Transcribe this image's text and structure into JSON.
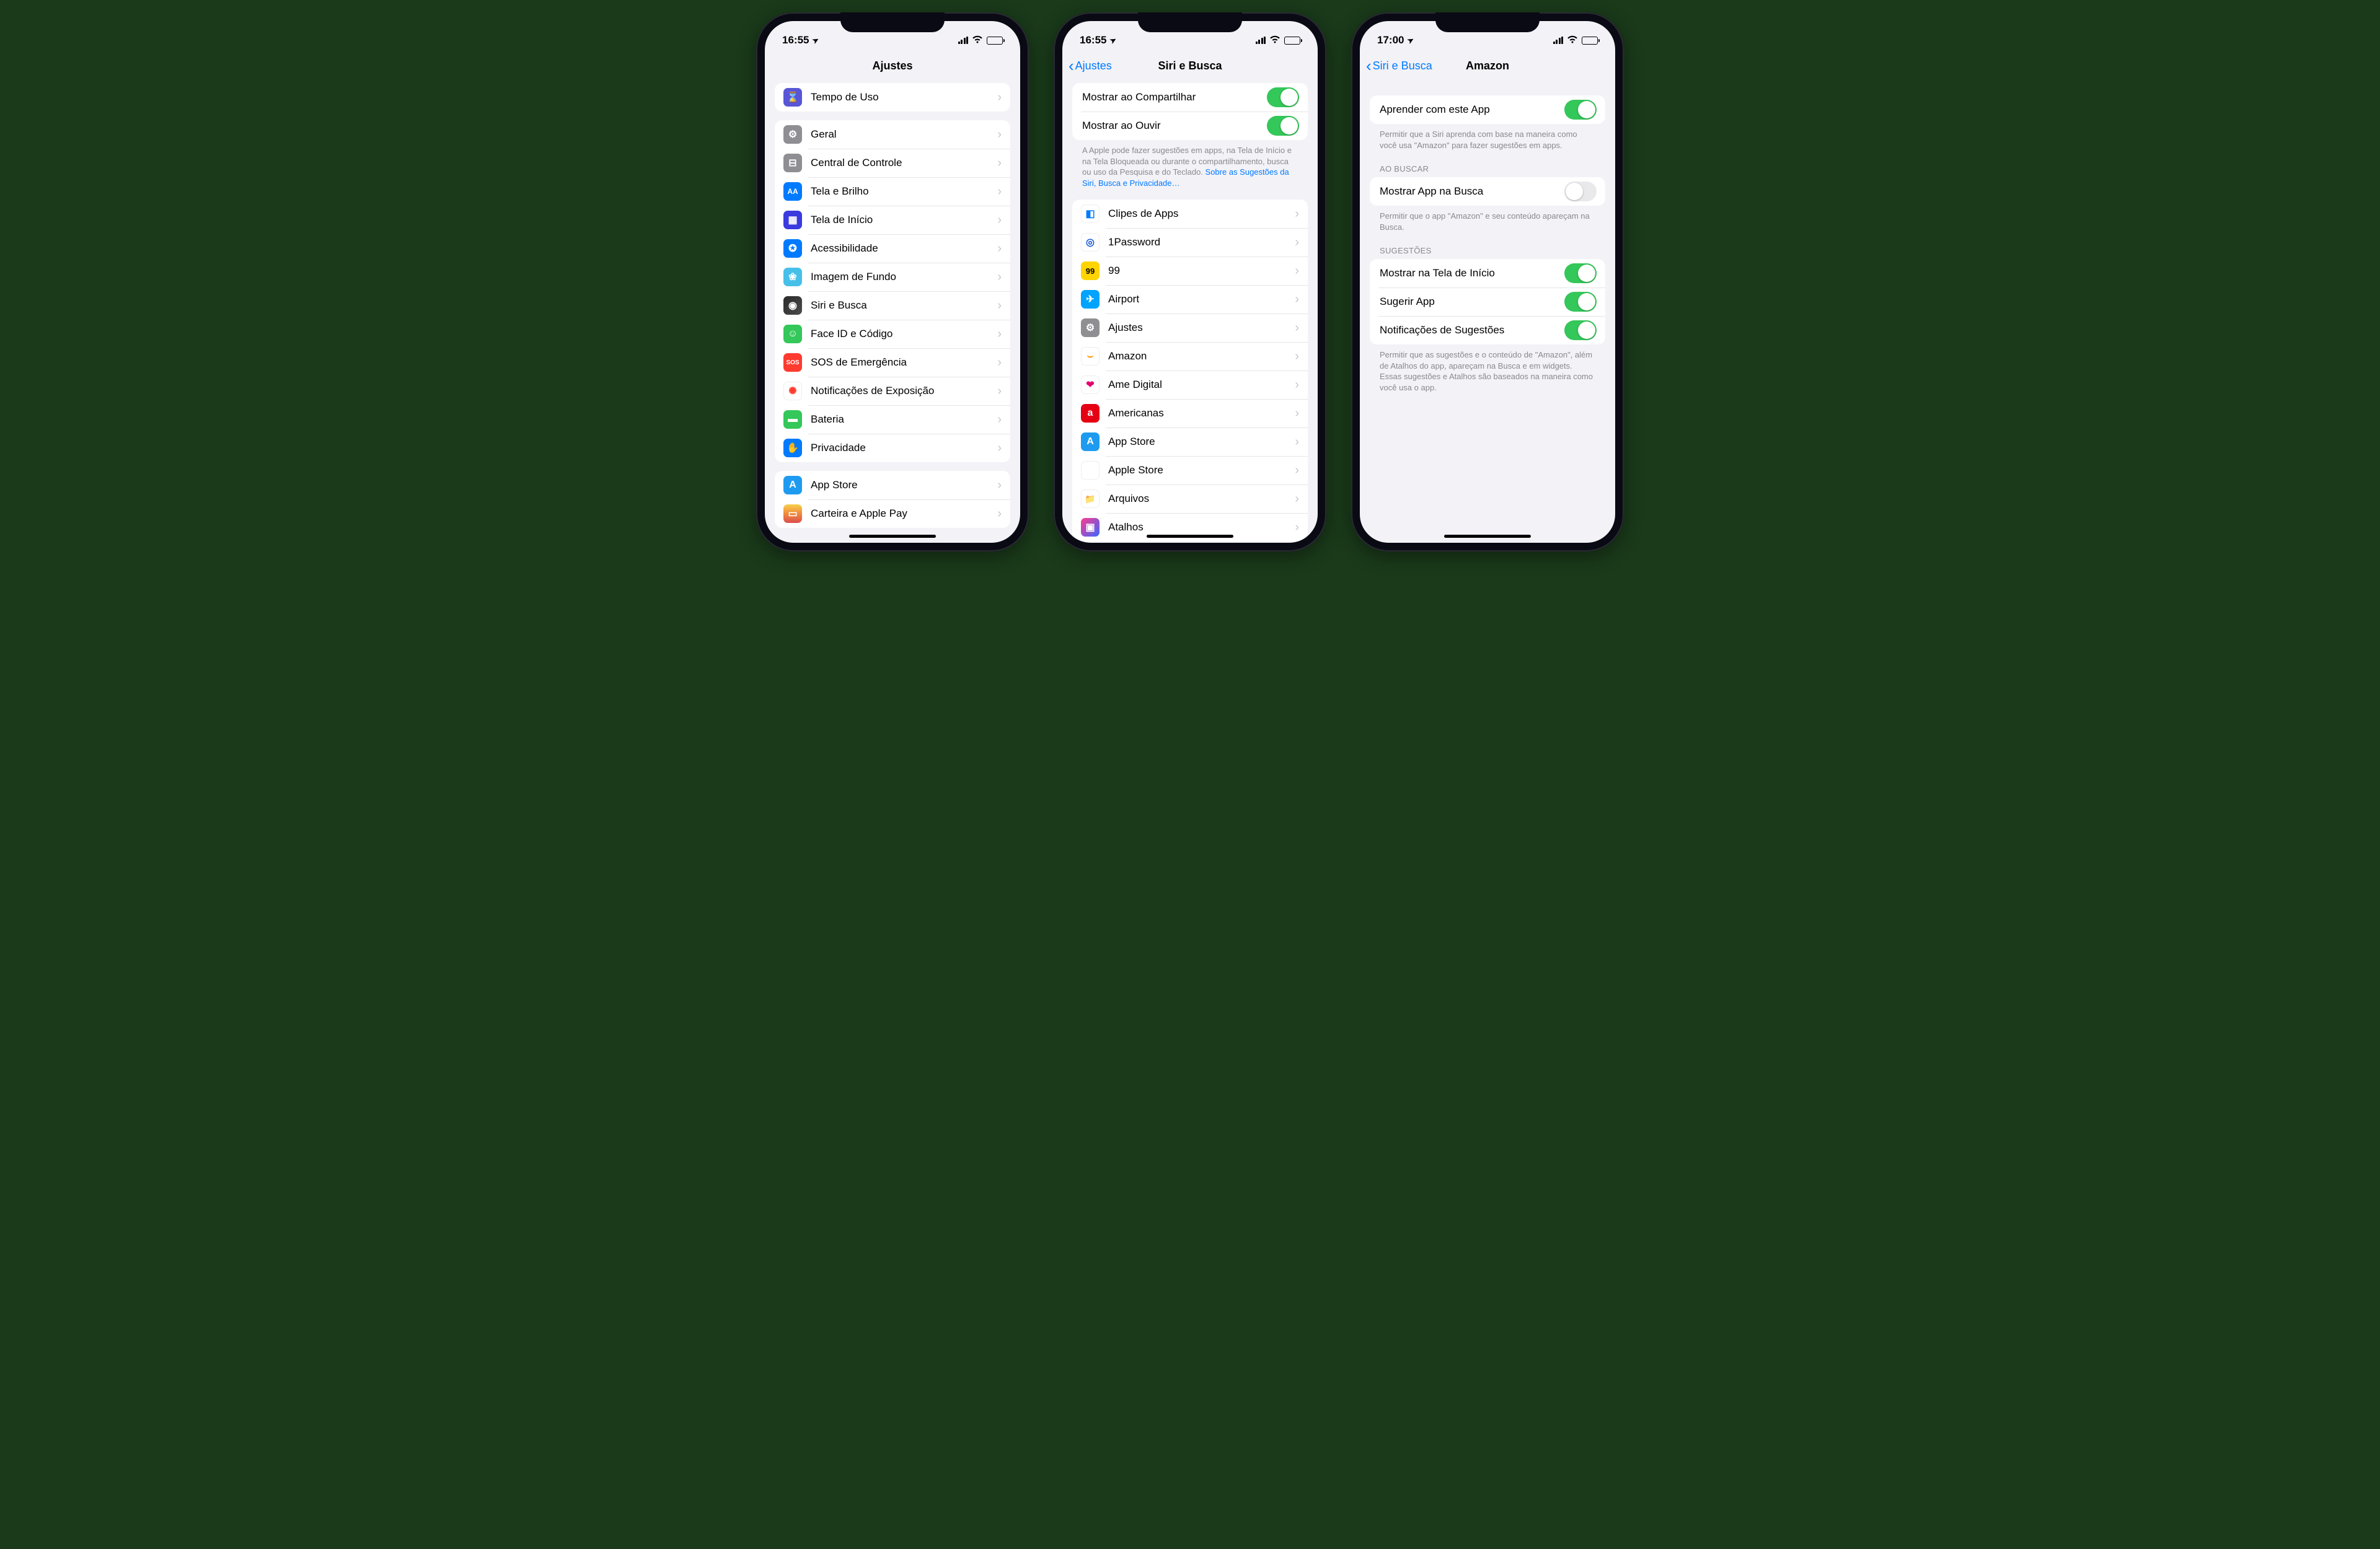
{
  "phones": [
    {
      "status": {
        "time": "16:55",
        "location_arrow": "➤"
      },
      "nav": {
        "title": "Ajustes",
        "back": null
      },
      "sections": [
        {
          "rows": [
            {
              "label": "Tempo de Uso",
              "icon_bg": "#5856d6",
              "glyph": "⌛",
              "kind": "disclosure"
            }
          ]
        },
        {
          "rows": [
            {
              "label": "Geral",
              "icon_bg": "#8e8e93",
              "glyph": "⚙",
              "kind": "disclosure"
            },
            {
              "label": "Central de Controle",
              "icon_bg": "#8e8e93",
              "glyph": "⊟",
              "kind": "disclosure"
            },
            {
              "label": "Tela e Brilho",
              "icon_bg": "#007aff",
              "glyph": "AA",
              "kind": "disclosure"
            },
            {
              "label": "Tela de Início",
              "icon_bg": "#3a3adf",
              "glyph": "▦",
              "kind": "disclosure"
            },
            {
              "label": "Acessibilidade",
              "icon_bg": "#007aff",
              "glyph": "✪",
              "kind": "disclosure"
            },
            {
              "label": "Imagem de Fundo",
              "icon_bg": "#46c0e9",
              "glyph": "❀",
              "kind": "disclosure"
            },
            {
              "label": "Siri e Busca",
              "icon_bg": "linear-gradient(135deg,#2a2a2a,#4b4b4b)",
              "glyph": "◉",
              "kind": "disclosure"
            },
            {
              "label": "Face ID e Código",
              "icon_bg": "#34c759",
              "glyph": "☺",
              "kind": "disclosure"
            },
            {
              "label": "SOS de Emergência",
              "icon_bg": "#ff3b30",
              "glyph": "SOS",
              "kind": "disclosure",
              "glyph_small": true
            },
            {
              "label": "Notificações de Exposição",
              "icon_bg": "#ffffff",
              "glyph": "✺",
              "glyph_color": "#ff3b30",
              "kind": "disclosure",
              "border": true
            },
            {
              "label": "Bateria",
              "icon_bg": "#34c759",
              "glyph": "▬",
              "kind": "disclosure"
            },
            {
              "label": "Privacidade",
              "icon_bg": "#007aff",
              "glyph": "✋",
              "kind": "disclosure"
            }
          ]
        },
        {
          "rows": [
            {
              "label": "App Store",
              "icon_bg": "#1e9bf0",
              "glyph": "A",
              "kind": "disclosure"
            },
            {
              "label": "Carteira e Apple Pay",
              "icon_bg": "#000",
              "glyph": "▭",
              "kind": "disclosure"
            }
          ]
        }
      ]
    },
    {
      "status": {
        "time": "16:55",
        "location_arrow": "➤"
      },
      "nav": {
        "title": "Siri e Busca",
        "back": "Ajustes"
      },
      "sections": [
        {
          "rows": [
            {
              "label": "Mostrar ao Compartilhar",
              "kind": "toggle",
              "on": true,
              "no_icon": true
            },
            {
              "label": "Mostrar ao Ouvir",
              "kind": "toggle",
              "on": true,
              "no_icon": true
            }
          ],
          "footer": "A Apple pode fazer sugestões em apps, na Tela de Início e na Tela Bloqueada ou durante o compartilhamento, busca ou uso da Pesquisa e do Teclado. ",
          "footer_link": "Sobre as Sugestões da Siri, Busca e Privacidade…"
        },
        {
          "rows": [
            {
              "label": "Clipes de Apps",
              "icon_bg": "#ffffff",
              "glyph": "◧",
              "glyph_color": "#007aff",
              "kind": "disclosure",
              "border": true
            },
            {
              "label": "1Password",
              "icon_bg": "#ffffff",
              "glyph": "◎",
              "glyph_color": "#1a59d8",
              "kind": "disclosure",
              "border": true
            },
            {
              "label": "99",
              "icon_bg": "#ffd400",
              "glyph": "99",
              "glyph_color": "#000",
              "kind": "disclosure",
              "glyph_small": true
            },
            {
              "label": "Airport",
              "icon_bg": "#00a3ff",
              "glyph": "✈",
              "kind": "disclosure"
            },
            {
              "label": "Ajustes",
              "icon_bg": "#8e8e93",
              "glyph": "⚙",
              "kind": "disclosure"
            },
            {
              "label": "Amazon",
              "icon_bg": "#ffffff",
              "glyph": "⌣",
              "glyph_color": "#ff9900",
              "kind": "disclosure",
              "border": true
            },
            {
              "label": "Ame Digital",
              "icon_bg": "#ffffff",
              "glyph": "❤",
              "glyph_color": "#e5006e",
              "kind": "disclosure",
              "border": true
            },
            {
              "label": "Americanas",
              "icon_bg": "#e60014",
              "glyph": "a",
              "kind": "disclosure"
            },
            {
              "label": "App Store",
              "icon_bg": "#1e9bf0",
              "glyph": "A",
              "kind": "disclosure"
            },
            {
              "label": "Apple Store",
              "icon_bg": "#ffffff",
              "glyph": "🛍",
              "glyph_color": "#007aff",
              "kind": "disclosure",
              "border": true
            },
            {
              "label": "Arquivos",
              "icon_bg": "#ffffff",
              "glyph": "📁",
              "kind": "disclosure",
              "border": true
            },
            {
              "label": "Atalhos",
              "icon_bg": "linear-gradient(135deg,#ff3b8e,#3a66ff)",
              "glyph": "▣",
              "kind": "disclosure"
            }
          ]
        }
      ]
    },
    {
      "status": {
        "time": "17:00",
        "location_arrow": "➤"
      },
      "nav": {
        "title": "Amazon",
        "back": "Siri e Busca"
      },
      "sections": [
        {
          "rows": [
            {
              "label": "Aprender com este App",
              "kind": "toggle",
              "on": true,
              "no_icon": true
            }
          ],
          "footer": "Permitir que a Siri aprenda com base na maneira como você usa \"Amazon\" para fazer sugestões em apps."
        },
        {
          "header": "AO BUSCAR",
          "rows": [
            {
              "label": "Mostrar App na Busca",
              "kind": "toggle",
              "on": false,
              "no_icon": true
            }
          ],
          "footer": "Permitir que o app \"Amazon\" e seu conteúdo apareçam na Busca."
        },
        {
          "header": "SUGESTÕES",
          "rows": [
            {
              "label": "Mostrar na Tela de Início",
              "kind": "toggle",
              "on": true,
              "no_icon": true
            },
            {
              "label": "Sugerir App",
              "kind": "toggle",
              "on": true,
              "no_icon": true
            },
            {
              "label": "Notificações de Sugestões",
              "kind": "toggle",
              "on": true,
              "no_icon": true
            }
          ],
          "footer": "Permitir que as sugestões e o conteúdo de \"Amazon\", além de Atalhos do app, apareçam na Busca e em widgets. Essas sugestões e Atalhos são baseados na maneira como você usa o app."
        }
      ]
    }
  ]
}
